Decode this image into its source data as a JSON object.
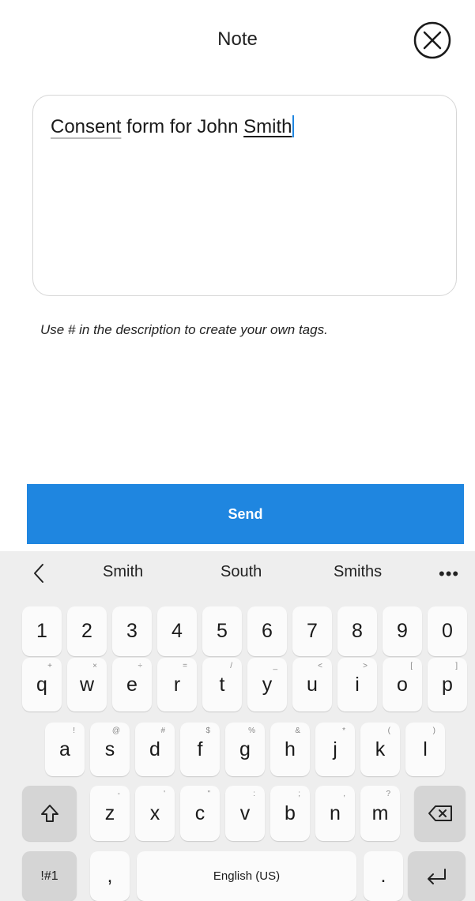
{
  "header": {
    "title": "Note"
  },
  "note": {
    "word1": "Consent",
    "text_mid": " form for John ",
    "word2": "Smith"
  },
  "hint": "Use # in the description to create your own tags.",
  "send_label": "Send",
  "keyboard": {
    "suggestions": [
      "Smith",
      "South",
      "Smiths"
    ],
    "more": "•••",
    "numbers": [
      "1",
      "2",
      "3",
      "4",
      "5",
      "6",
      "7",
      "8",
      "9",
      "0"
    ],
    "row1": [
      {
        "k": "q",
        "s": "+"
      },
      {
        "k": "w",
        "s": "×"
      },
      {
        "k": "e",
        "s": "÷"
      },
      {
        "k": "r",
        "s": "="
      },
      {
        "k": "t",
        "s": "/"
      },
      {
        "k": "y",
        "s": "_"
      },
      {
        "k": "u",
        "s": "<"
      },
      {
        "k": "i",
        "s": ">"
      },
      {
        "k": "o",
        "s": "["
      },
      {
        "k": "p",
        "s": "]"
      }
    ],
    "row2": [
      {
        "k": "a",
        "s": "!"
      },
      {
        "k": "s",
        "s": "@"
      },
      {
        "k": "d",
        "s": "#"
      },
      {
        "k": "f",
        "s": "$"
      },
      {
        "k": "g",
        "s": "%"
      },
      {
        "k": "h",
        "s": "&"
      },
      {
        "k": "j",
        "s": "*"
      },
      {
        "k": "k",
        "s": "("
      },
      {
        "k": "l",
        "s": ")"
      }
    ],
    "row3": [
      {
        "k": "z",
        "s": "-"
      },
      {
        "k": "x",
        "s": "'"
      },
      {
        "k": "c",
        "s": "\""
      },
      {
        "k": "v",
        "s": ":"
      },
      {
        "k": "b",
        "s": ";"
      },
      {
        "k": "n",
        "s": ","
      },
      {
        "k": "m",
        "s": "?"
      }
    ],
    "symbols_label": "!#1",
    "comma_label": ",",
    "space_label": "English (US)",
    "period_label": "."
  }
}
